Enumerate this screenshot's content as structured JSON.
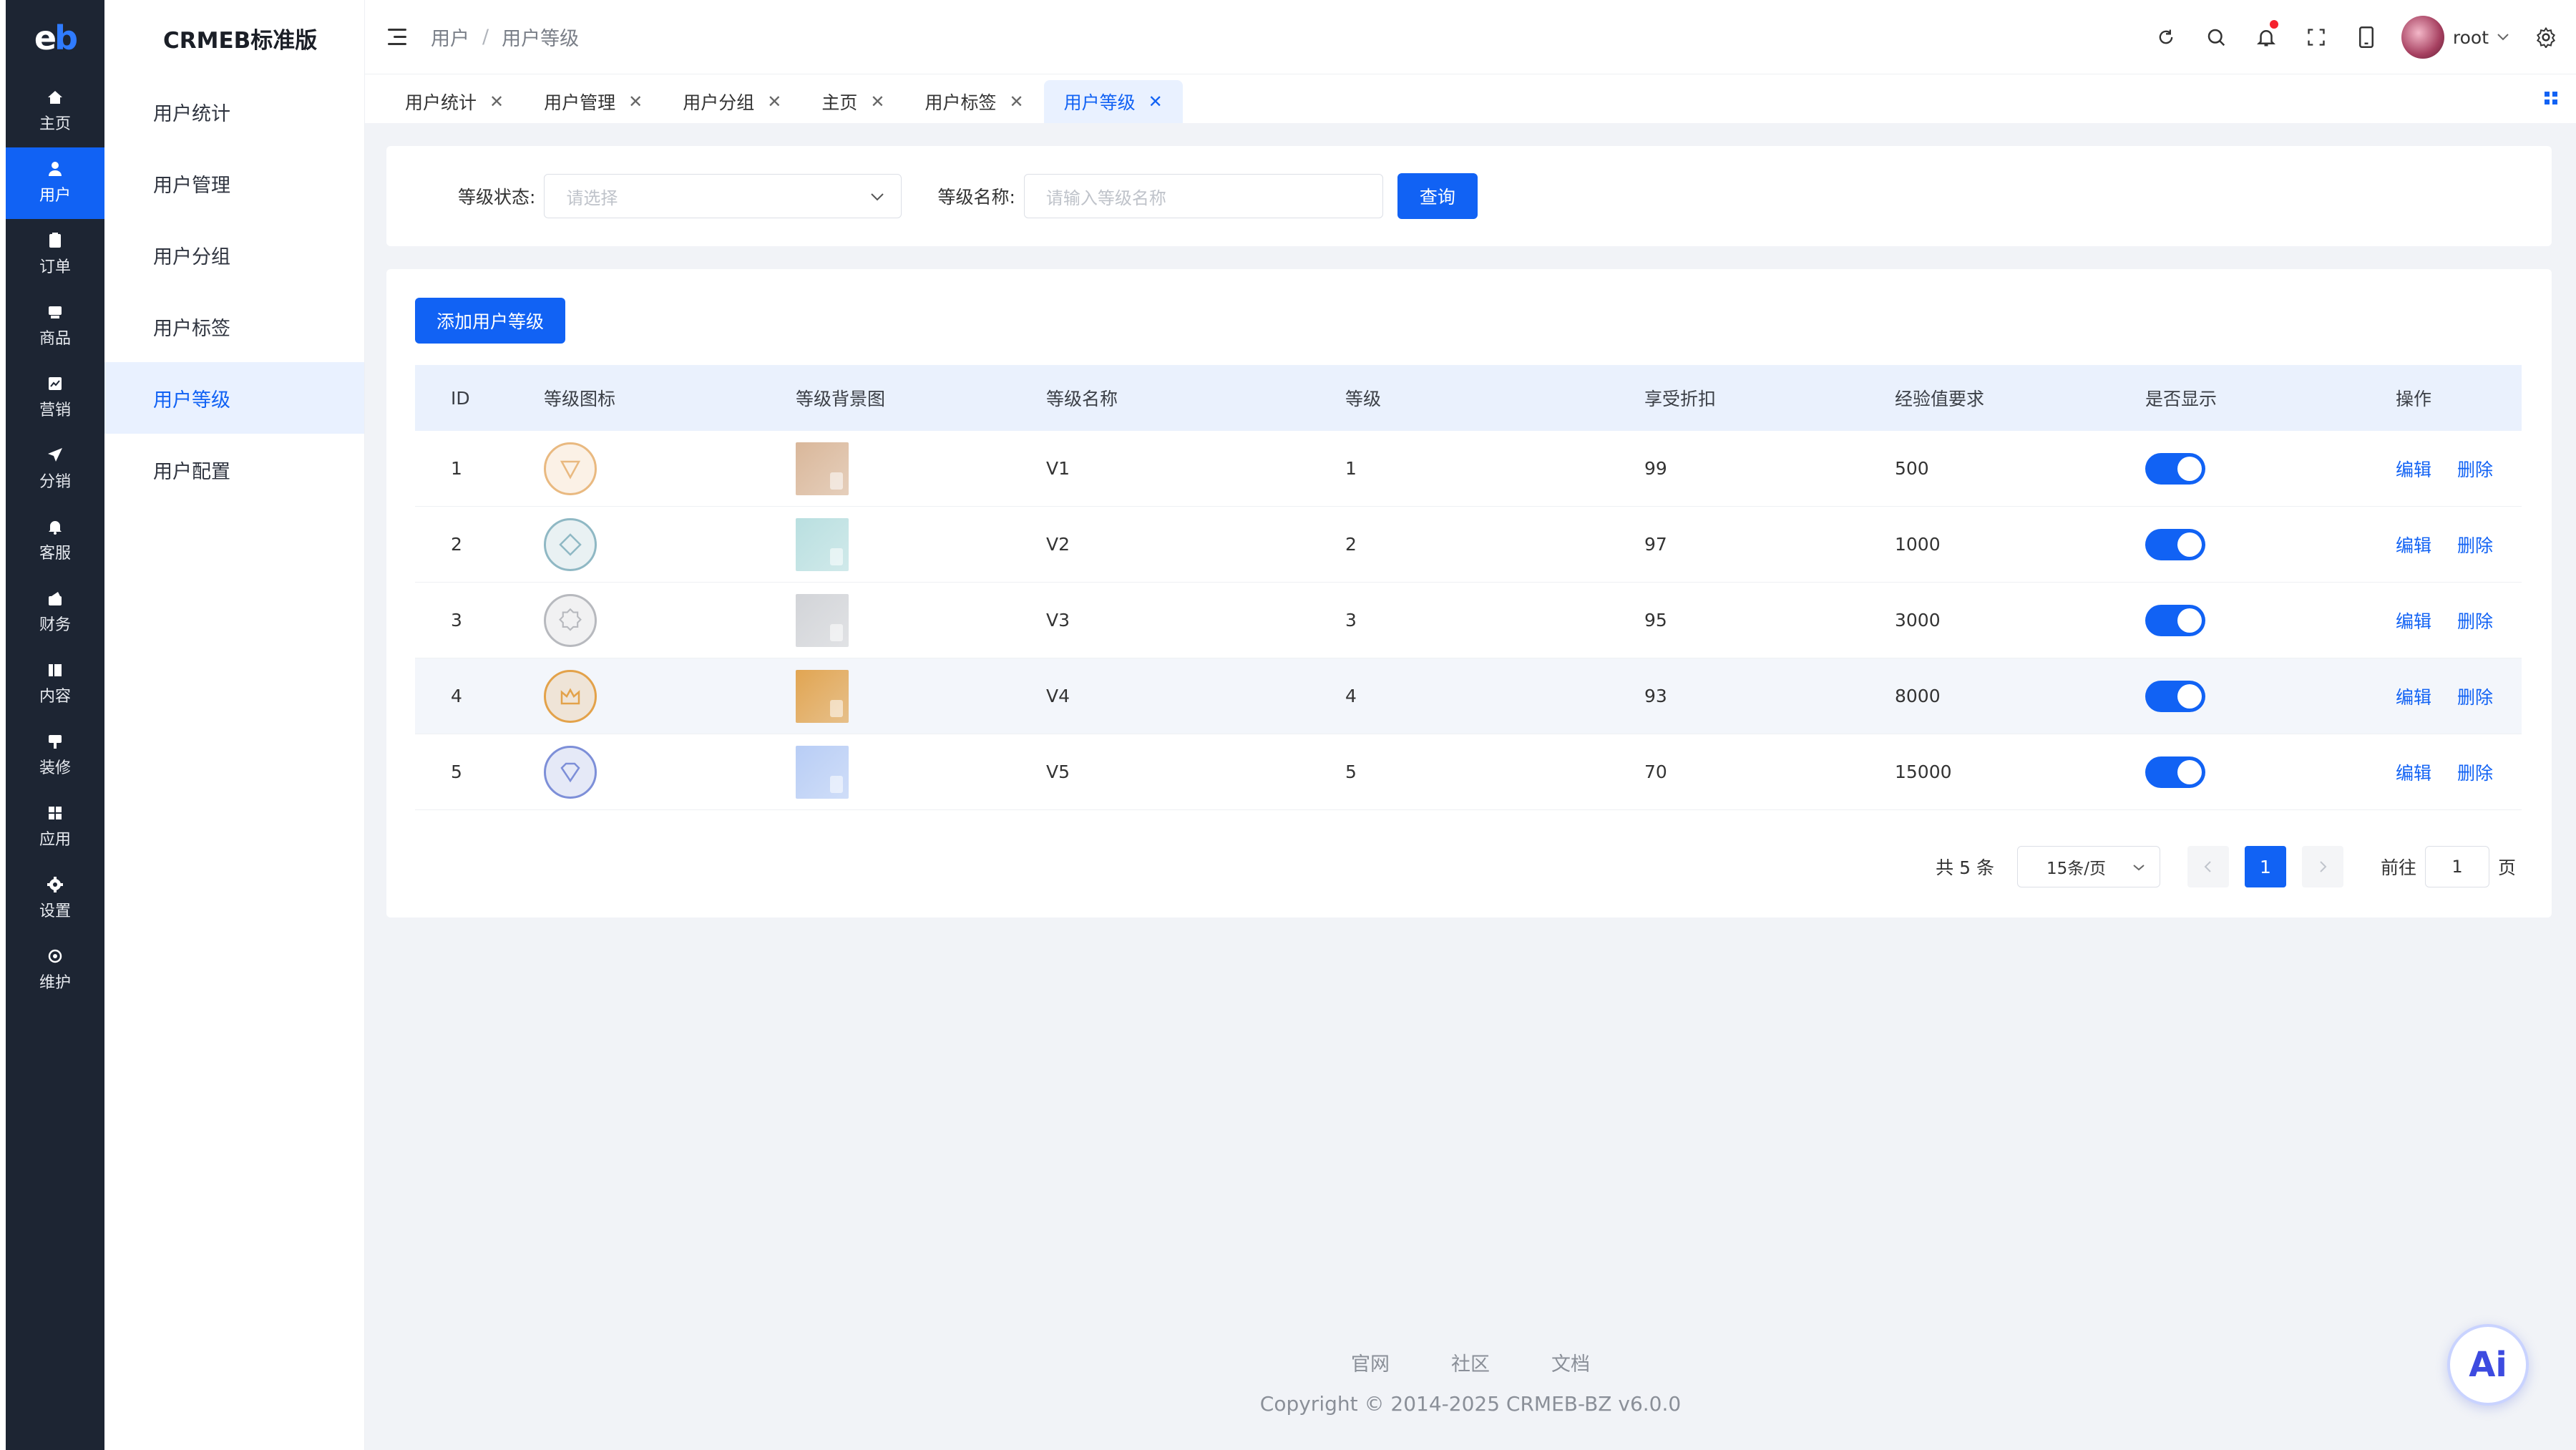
{
  "logo": "eb",
  "rail": [
    {
      "label": "主页",
      "icon": "home-icon"
    },
    {
      "label": "用户",
      "icon": "user-icon"
    },
    {
      "label": "订单",
      "icon": "order-icon"
    },
    {
      "label": "商品",
      "icon": "product-icon"
    },
    {
      "label": "营销",
      "icon": "marketing-icon"
    },
    {
      "label": "分销",
      "icon": "distribution-icon"
    },
    {
      "label": "客服",
      "icon": "service-bell-icon"
    },
    {
      "label": "财务",
      "icon": "finance-icon"
    },
    {
      "label": "内容",
      "icon": "content-icon"
    },
    {
      "label": "装修",
      "icon": "decoration-icon"
    },
    {
      "label": "应用",
      "icon": "apps-grid-icon"
    },
    {
      "label": "设置",
      "icon": "gear-icon"
    },
    {
      "label": "维护",
      "icon": "maintenance-icon"
    }
  ],
  "subnav": {
    "brand": "CRMEB标准版",
    "items": [
      "用户统计",
      "用户管理",
      "用户分组",
      "用户标签",
      "用户等级",
      "用户配置"
    ]
  },
  "header": {
    "breadcrumb": [
      "用户",
      "/",
      "用户等级"
    ],
    "user": "root"
  },
  "tabs": [
    "用户统计",
    "用户管理",
    "用户分组",
    "主页",
    "用户标签",
    "用户等级"
  ],
  "filter": {
    "status_label": "等级状态:",
    "status_placeholder": "请选择",
    "name_label": "等级名称:",
    "name_placeholder": "请输入等级名称",
    "query_button": "查询"
  },
  "table": {
    "add_button": "添加用户等级",
    "columns": [
      "ID",
      "等级图标",
      "等级背景图",
      "等级名称",
      "等级",
      "享受折扣",
      "经验值要求",
      "是否显示",
      "操作"
    ],
    "rows": [
      {
        "id": "1",
        "name": "V1",
        "level": "1",
        "discount": "99",
        "exp": "500",
        "shown": true,
        "badge_color": "#e9b980",
        "bg_color": "#d9b79a"
      },
      {
        "id": "2",
        "name": "V2",
        "level": "2",
        "discount": "97",
        "exp": "1000",
        "shown": true,
        "badge_color": "#8fb8c4",
        "bg_color": "#b9dfe0"
      },
      {
        "id": "3",
        "name": "V3",
        "level": "3",
        "discount": "95",
        "exp": "3000",
        "shown": true,
        "badge_color": "#b7b9be",
        "bg_color": "#d2d4d8"
      },
      {
        "id": "4",
        "name": "V4",
        "level": "4",
        "discount": "93",
        "exp": "8000",
        "shown": true,
        "badge_color": "#e3a24a",
        "bg_color": "#e1a552"
      },
      {
        "id": "5",
        "name": "V5",
        "level": "5",
        "discount": "70",
        "exp": "15000",
        "shown": true,
        "badge_color": "#7d8fd8",
        "bg_color": "#b8cdf5"
      }
    ],
    "edit_label": "编辑",
    "delete_label": "删除"
  },
  "pagination": {
    "total": "共 5 条",
    "page_size": "15条/页",
    "current_page": "1",
    "goto_label": "前往",
    "goto_value": "1",
    "page_suffix": "页"
  },
  "footer": {
    "links": [
      "官网",
      "社区",
      "文档"
    ],
    "copyright": "Copyright © 2014-2025 CRMEB-BZ v6.0.0"
  },
  "ai_label": "Ai",
  "colors": {
    "accent": "#1162f4",
    "rail_bg": "#1d2533"
  }
}
